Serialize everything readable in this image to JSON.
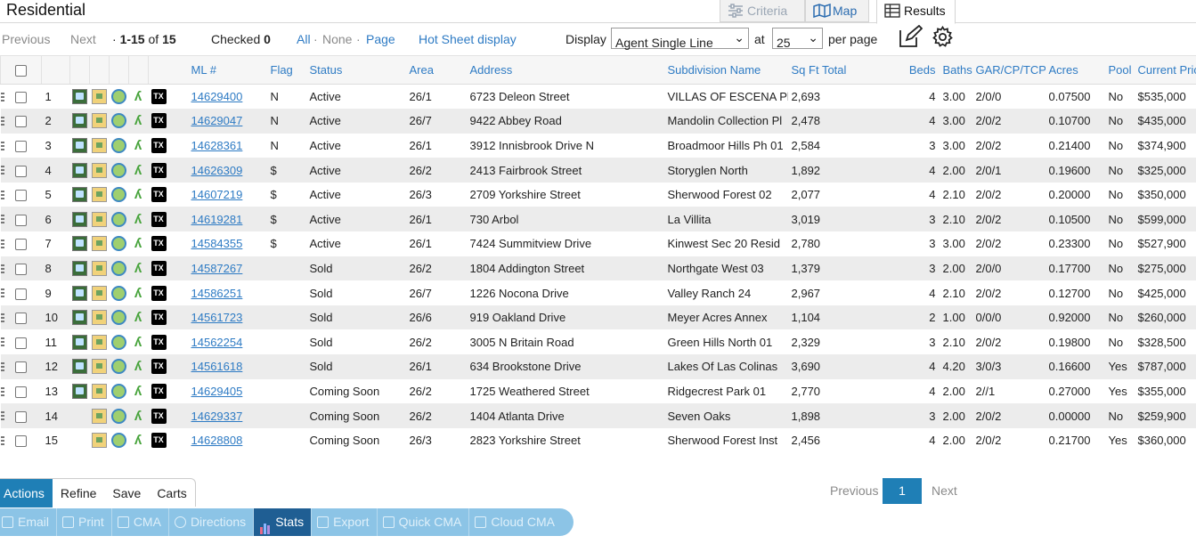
{
  "header": {
    "title": "Residential"
  },
  "view_tabs": [
    {
      "label": "Criteria"
    },
    {
      "label": "Map"
    },
    {
      "label": "Results"
    }
  ],
  "results_bar": {
    "previous": "Previous",
    "next": "Next",
    "range": "1-15",
    "of": "of",
    "total": "15",
    "checked_label": "Checked",
    "checked_count": "0",
    "all": "All",
    "none": "None",
    "page": "Page",
    "hot_sheet": "Hot Sheet display",
    "display_label": "Display",
    "display_value": "Agent Single Line",
    "at_label": "at",
    "per_page_value": "25",
    "per_page_label": "per page"
  },
  "table": {
    "headers": [
      "ML #",
      "Flag",
      "Status",
      "Area",
      "Address",
      "Subdivision Name",
      "Sq Ft Total",
      "Beds",
      "Baths",
      "GAR/CP/TCP",
      "Acres",
      "Pool",
      "Current Price"
    ],
    "rows": [
      {
        "n": "1",
        "ml": "14629400",
        "flag": "N",
        "status": "Active",
        "area": "26/1",
        "address": "6723 Deleon Street",
        "subdivision": "VILLAS OF ESCENA Ph",
        "sqft": "2,693",
        "beds": "4",
        "baths": "3.00",
        "gar": "2/0/0",
        "acres": "0.07500",
        "pool": "No",
        "price": "$535,000",
        "pic": true
      },
      {
        "n": "2",
        "ml": "14629047",
        "flag": "N",
        "status": "Active",
        "area": "26/7",
        "address": "9422 Abbey Road",
        "subdivision": "Mandolin Collection Pl",
        "sqft": "2,478",
        "beds": "4",
        "baths": "3.00",
        "gar": "2/0/2",
        "acres": "0.10700",
        "pool": "No",
        "price": "$435,000",
        "pic": true
      },
      {
        "n": "3",
        "ml": "14628361",
        "flag": "N",
        "status": "Active",
        "area": "26/1",
        "address": "3912 Innisbrook Drive N",
        "subdivision": "Broadmoor Hills Ph 01",
        "sqft": "2,584",
        "beds": "3",
        "baths": "3.00",
        "gar": "2/0/2",
        "acres": "0.21400",
        "pool": "No",
        "price": "$374,900",
        "pic": true
      },
      {
        "n": "4",
        "ml": "14626309",
        "flag": "$",
        "status": "Active",
        "area": "26/2",
        "address": "2413 Fairbrook Street",
        "subdivision": "Storyglen North",
        "sqft": "1,892",
        "beds": "4",
        "baths": "2.00",
        "gar": "2/0/1",
        "acres": "0.19600",
        "pool": "No",
        "price": "$325,000",
        "pic": true
      },
      {
        "n": "5",
        "ml": "14607219",
        "flag": "$",
        "status": "Active",
        "area": "26/3",
        "address": "2709 Yorkshire Street",
        "subdivision": "Sherwood Forest 02",
        "sqft": "2,077",
        "beds": "4",
        "baths": "2.10",
        "gar": "2/0/2",
        "acres": "0.20000",
        "pool": "No",
        "price": "$350,000",
        "pic": true
      },
      {
        "n": "6",
        "ml": "14619281",
        "flag": "$",
        "status": "Active",
        "area": "26/1",
        "address": "730 Arbol",
        "subdivision": "La Villita",
        "sqft": "3,019",
        "beds": "3",
        "baths": "2.10",
        "gar": "2/0/2",
        "acres": "0.10500",
        "pool": "No",
        "price": "$599,000",
        "pic": true
      },
      {
        "n": "7",
        "ml": "14584355",
        "flag": "$",
        "status": "Active",
        "area": "26/1",
        "address": "7424 Summitview Drive",
        "subdivision": "Kinwest Sec 20 Resid",
        "sqft": "2,780",
        "beds": "3",
        "baths": "3.00",
        "gar": "2/0/2",
        "acres": "0.23300",
        "pool": "No",
        "price": "$527,900",
        "pic": true
      },
      {
        "n": "8",
        "ml": "14587267",
        "flag": "",
        "status": "Sold",
        "area": "26/2",
        "address": "1804 Addington Street",
        "subdivision": "Northgate West 03",
        "sqft": "1,379",
        "beds": "3",
        "baths": "2.00",
        "gar": "2/0/0",
        "acres": "0.17700",
        "pool": "No",
        "price": "$275,000",
        "pic": true
      },
      {
        "n": "9",
        "ml": "14586251",
        "flag": "",
        "status": "Sold",
        "area": "26/7",
        "address": "1226 Nocona Drive",
        "subdivision": "Valley Ranch 24",
        "sqft": "2,967",
        "beds": "4",
        "baths": "2.10",
        "gar": "2/0/2",
        "acres": "0.12700",
        "pool": "No",
        "price": "$425,000",
        "pic": true
      },
      {
        "n": "10",
        "ml": "14561723",
        "flag": "",
        "status": "Sold",
        "area": "26/6",
        "address": "919 Oakland Drive",
        "subdivision": "Meyer Acres Annex",
        "sqft": "1,104",
        "beds": "2",
        "baths": "1.00",
        "gar": "0/0/0",
        "acres": "0.92000",
        "pool": "No",
        "price": "$260,000",
        "pic": true
      },
      {
        "n": "11",
        "ml": "14562254",
        "flag": "",
        "status": "Sold",
        "area": "26/2",
        "address": "3005 N Britain Road",
        "subdivision": "Green Hills North 01",
        "sqft": "2,329",
        "beds": "3",
        "baths": "2.10",
        "gar": "2/0/2",
        "acres": "0.19800",
        "pool": "No",
        "price": "$328,500",
        "pic": true
      },
      {
        "n": "12",
        "ml": "14561618",
        "flag": "",
        "status": "Sold",
        "area": "26/1",
        "address": "634 Brookstone Drive",
        "subdivision": "Lakes Of Las Colinas",
        "sqft": "3,690",
        "beds": "4",
        "baths": "4.20",
        "gar": "3/0/3",
        "acres": "0.16600",
        "pool": "Yes",
        "price": "$787,000",
        "pic": true
      },
      {
        "n": "13",
        "ml": "14629405",
        "flag": "",
        "status": "Coming Soon",
        "area": "26/2",
        "address": "1725 Weathered Street",
        "subdivision": "Ridgecrest Park 01",
        "sqft": "2,770",
        "beds": "4",
        "baths": "2.00",
        "gar": "2//1",
        "acres": "0.27000",
        "pool": "Yes",
        "price": "$355,000",
        "pic": true
      },
      {
        "n": "14",
        "ml": "14629337",
        "flag": "",
        "status": "Coming Soon",
        "area": "26/2",
        "address": "1404 Atlanta Drive",
        "subdivision": "Seven Oaks",
        "sqft": "1,898",
        "beds": "3",
        "baths": "2.00",
        "gar": "2/0/2",
        "acres": "0.00000",
        "pool": "No",
        "price": "$259,900",
        "pic": false
      },
      {
        "n": "15",
        "ml": "14628808",
        "flag": "",
        "status": "Coming Soon",
        "area": "26/3",
        "address": "2823 Yorkshire Street",
        "subdivision": "Sherwood Forest Inst",
        "sqft": "2,456",
        "beds": "4",
        "baths": "2.00",
        "gar": "2/0/2",
        "acres": "0.21700",
        "pool": "Yes",
        "price": "$360,000",
        "pic": false
      }
    ]
  },
  "bottom_tabs": [
    "Actions",
    "Refine",
    "Save",
    "Carts"
  ],
  "pager": {
    "previous": "Previous",
    "page": "1",
    "next": "Next"
  },
  "action_bar": [
    "Email",
    "Print",
    "CMA",
    "Directions",
    "Stats",
    "Export",
    "Quick CMA",
    "Cloud CMA"
  ],
  "colors": {
    "accent": "#2e7bc4",
    "active_tab": "#1f7fb6",
    "action_bar": "#8cc4e6",
    "stats_active": "#1f5e93"
  }
}
